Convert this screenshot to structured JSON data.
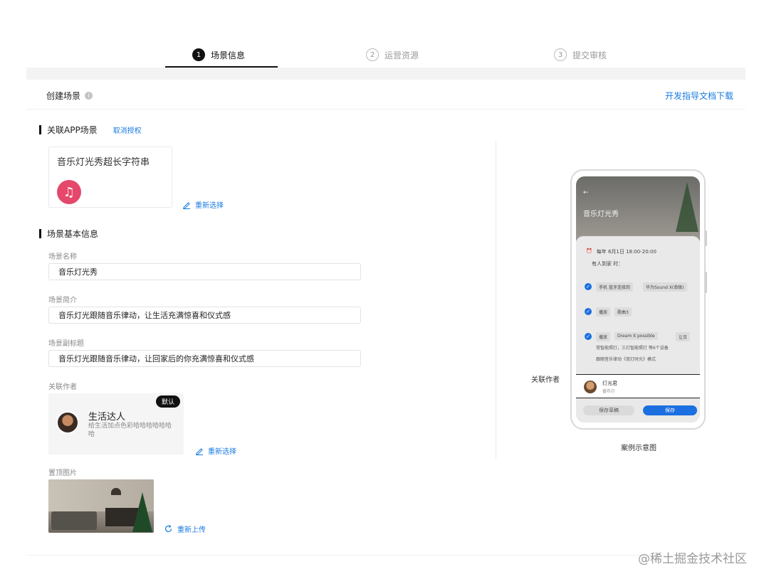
{
  "stepper": {
    "steps": [
      {
        "num": "1",
        "label": "场景信息"
      },
      {
        "num": "2",
        "label": "运营资源"
      },
      {
        "num": "3",
        "label": "提交审核"
      }
    ]
  },
  "header": {
    "title": "创建场景",
    "info_icon": "i",
    "doc_link": "开发指导文档下载"
  },
  "app_section": {
    "title": "关联APP场景",
    "cancel_auth": "取消授权",
    "app_name": "音乐灯光秀超长字符串",
    "app_icon_glyph": "♫",
    "reselect": "重新选择"
  },
  "basic_section": {
    "title": "场景基本信息",
    "name_label": "场景名称",
    "name_value": "音乐灯光秀",
    "intro_label": "场景简介",
    "intro_value": "音乐灯光跟随音乐律动，让生活充满惊喜和仪式感",
    "subtitle_label": "场景副标题",
    "subtitle_value": "音乐灯光跟随音乐律动，让回家后的你充满惊喜和仪式感",
    "author_label": "关联作者",
    "author": {
      "name": "生活达人",
      "desc": "给生活加点色彩哈哈哈哈哈哈哈",
      "badge": "默认"
    },
    "author_reselect": "重新选择",
    "cover_label": "置顶图片",
    "reupload": "重新上传"
  },
  "preview": {
    "side_label": "关联作者",
    "caption": "案例示意图",
    "hero_title": "音乐灯光秀",
    "hero_back": "←",
    "time_row": [
      "每年 6月1日 18:00-20:00"
    ],
    "time_icon": "⏰",
    "sub_row": "有人到家  时：",
    "tasks": [
      {
        "chips": [
          "手机 蓝牙连接到",
          "华为Sound X(南极)"
        ]
      },
      {
        "chips": [
          "播放",
          "歌曲3"
        ]
      },
      {
        "chips": [
          "播放",
          "Dream it possible",
          "让日"
        ],
        "extra": [
          "常智能照灯，三灯智能照灯 等6个设备",
          "跟随音乐律动《双灯时光》模式"
        ]
      }
    ],
    "check_glyph": "✓",
    "author_name": "灯光君",
    "author_sub": "番布尔",
    "ghost_btn": "保存草稿",
    "save_btn": "保存"
  },
  "watermark": "@稀土掘金技术社区"
}
